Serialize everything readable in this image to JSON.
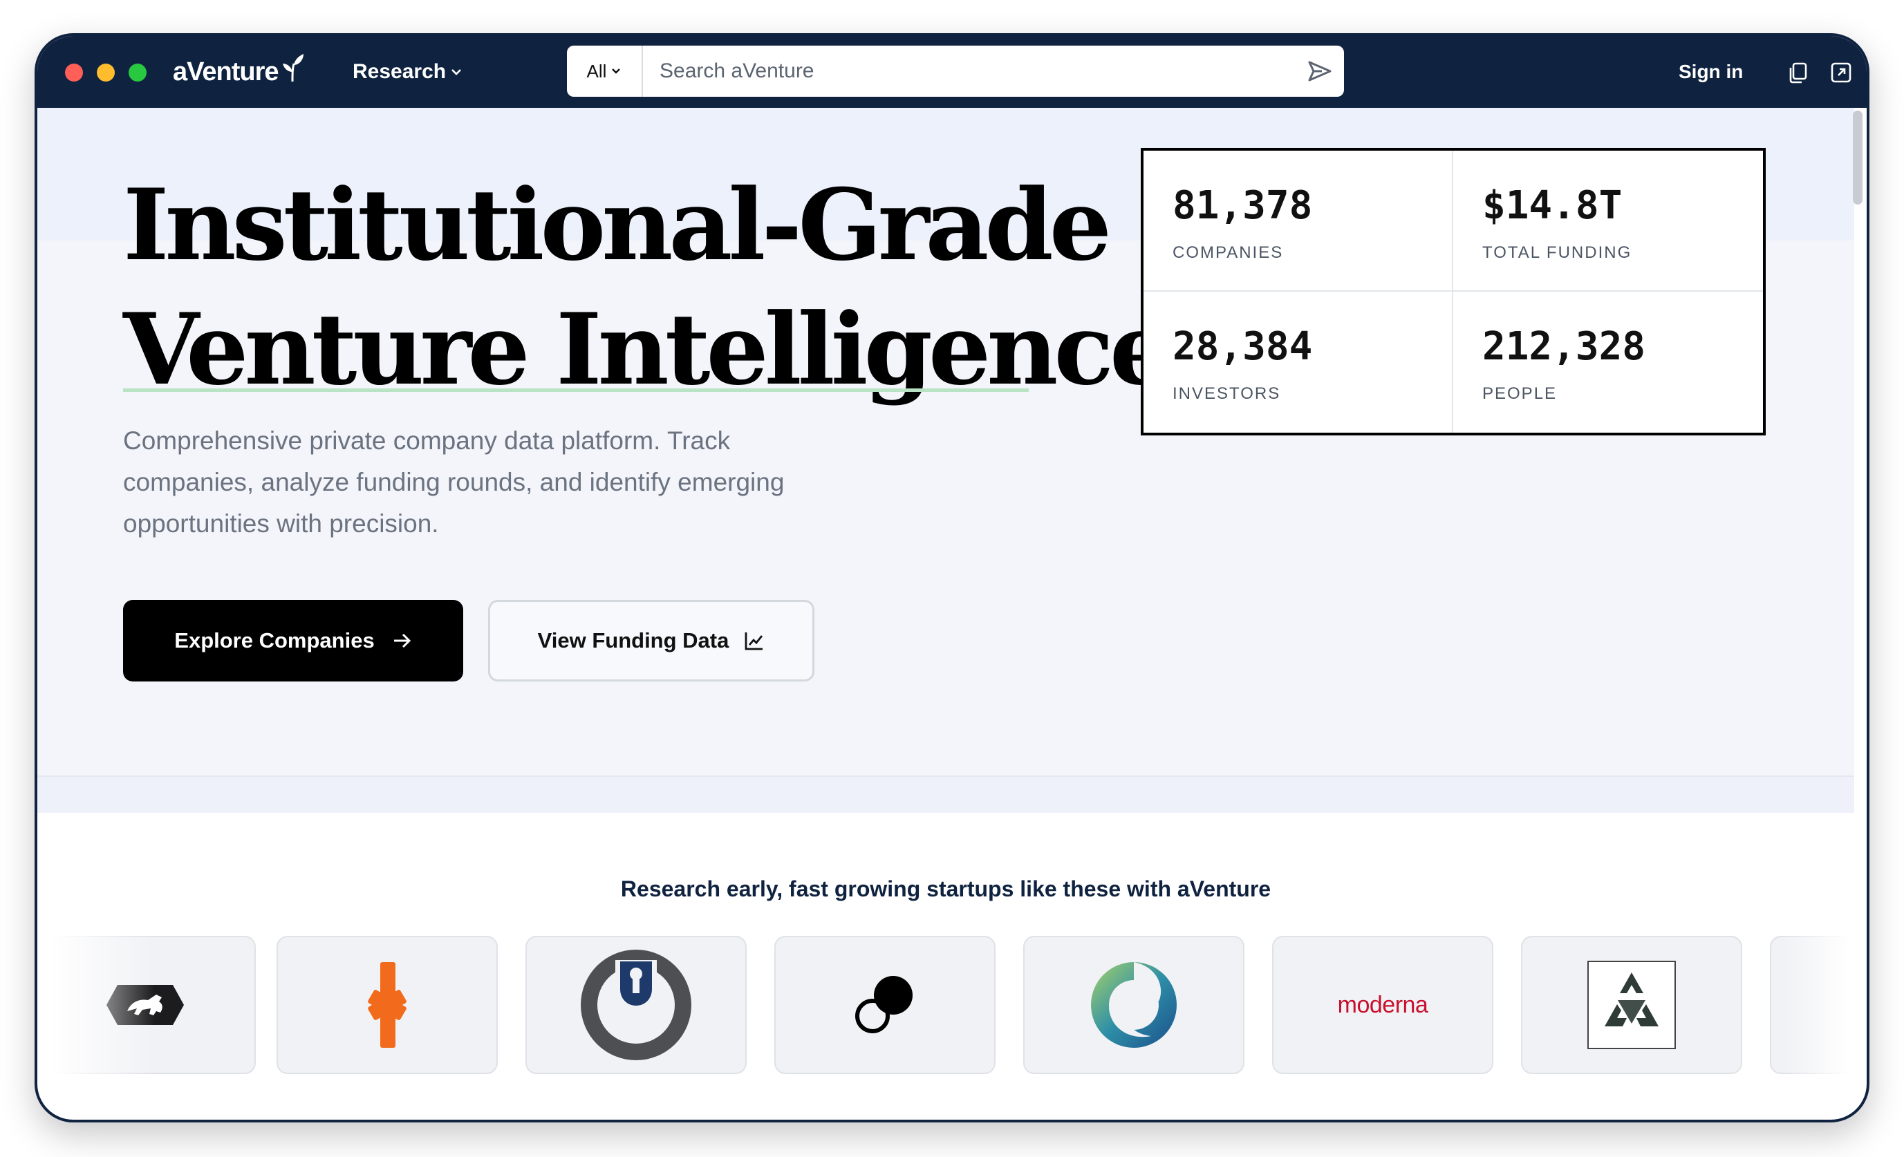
{
  "window": {
    "brand": "aVenture",
    "nav_research": "Research",
    "search": {
      "scope": "All",
      "placeholder": "Search aVenture"
    },
    "sign_in": "Sign in"
  },
  "hero": {
    "headline_line1": "Institutional-Grade",
    "headline_line2": "Venture Intelligence",
    "subtitle": "Comprehensive private company data platform. Track companies, analyze funding rounds, and identify emerging opportunities with precision.",
    "primary_button": "Explore Companies",
    "secondary_button": "View Funding Data"
  },
  "stats": [
    {
      "value": "81,378",
      "label": "COMPANIES"
    },
    {
      "value": "$14.8T",
      "label": "TOTAL FUNDING"
    },
    {
      "value": "28,384",
      "label": "INVESTORS"
    },
    {
      "value": "212,328",
      "label": "PEOPLE"
    }
  ],
  "logos_section": {
    "title": "Research early, fast growing startups like these with aVenture",
    "moderna_wordmark": "moderna"
  },
  "colors": {
    "navy": "#0f2340",
    "accent_green": "#b9e3c4",
    "orange": "#f26a1b",
    "moderna_red": "#c8102e"
  },
  "icons": [
    "leaf-icon",
    "chevron-down-icon",
    "send-icon",
    "copy-icon",
    "external-link-icon",
    "arrow-right-icon",
    "line-chart-icon"
  ]
}
